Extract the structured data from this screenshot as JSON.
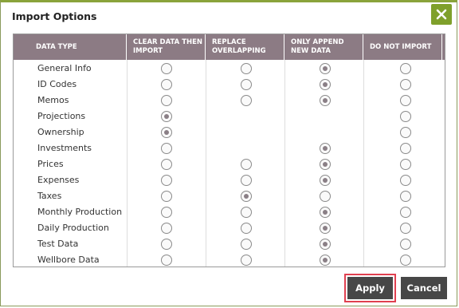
{
  "dialog": {
    "title": "Import Options",
    "close_icon": "close-x-icon"
  },
  "table": {
    "headers": [
      "DATA TYPE",
      "CLEAR DATA THEN IMPORT",
      "REPLACE OVERLAPPING",
      "ONLY APPEND NEW DATA",
      "DO NOT IMPORT"
    ],
    "rows": [
      {
        "label": "General Info",
        "options": [
          true,
          true,
          true,
          true
        ],
        "selected": 2
      },
      {
        "label": "ID Codes",
        "options": [
          true,
          true,
          true,
          true
        ],
        "selected": 2
      },
      {
        "label": "Memos",
        "options": [
          true,
          true,
          true,
          true
        ],
        "selected": 2
      },
      {
        "label": "Projections",
        "options": [
          true,
          false,
          false,
          true
        ],
        "selected": 0
      },
      {
        "label": "Ownership",
        "options": [
          true,
          false,
          false,
          true
        ],
        "selected": 0
      },
      {
        "label": "Investments",
        "options": [
          true,
          false,
          true,
          true
        ],
        "selected": 2
      },
      {
        "label": "Prices",
        "options": [
          true,
          true,
          true,
          true
        ],
        "selected": 2
      },
      {
        "label": "Expenses",
        "options": [
          true,
          true,
          true,
          true
        ],
        "selected": 2
      },
      {
        "label": "Taxes",
        "options": [
          true,
          true,
          true,
          true
        ],
        "selected": 1
      },
      {
        "label": "Monthly Production",
        "options": [
          true,
          true,
          true,
          true
        ],
        "selected": 2
      },
      {
        "label": "Daily Production",
        "options": [
          true,
          true,
          true,
          true
        ],
        "selected": 2
      },
      {
        "label": "Test Data",
        "options": [
          true,
          true,
          true,
          true
        ],
        "selected": 2
      },
      {
        "label": "Wellbore Data",
        "options": [
          true,
          true,
          true,
          true
        ],
        "selected": 2
      }
    ]
  },
  "buttons": {
    "apply_label": "Apply",
    "cancel_label": "Cancel"
  },
  "colors": {
    "accent": "#7fa02b",
    "header_bg": "#8c7b84",
    "button_bg": "#474747",
    "highlight": "#e04050"
  }
}
